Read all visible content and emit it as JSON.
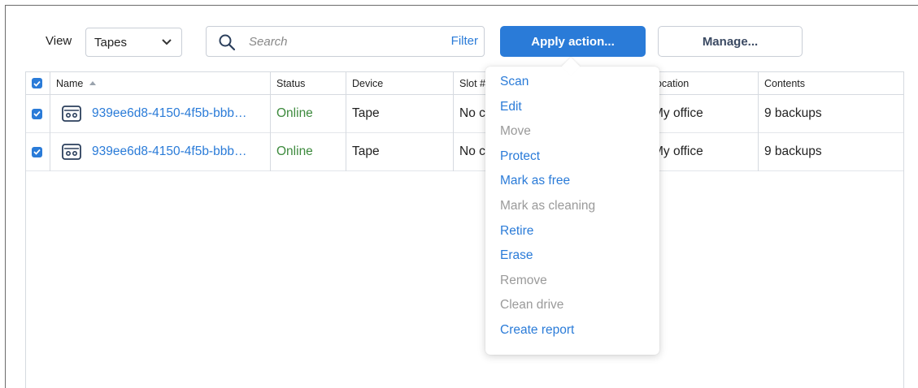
{
  "toolbar": {
    "view_label": "View",
    "view_value": "Tapes",
    "search_placeholder": "Search",
    "filter_label": "Filter",
    "apply_label": "Apply action...",
    "manage_label": "Manage..."
  },
  "table": {
    "columns": [
      "Name",
      "Status",
      "Device",
      "Slot #",
      "Location",
      "Contents"
    ],
    "sort_column": "Name",
    "sort_direction": "ascending",
    "select_all_checked": true,
    "rows": [
      {
        "checked": true,
        "icon": "tape-cassette-icon",
        "name": "939ee6d8-4150-4f5b-bbb…",
        "status": "Online",
        "device": "Tape",
        "slot": "No c",
        "location": "My office",
        "contents": "9 backups"
      },
      {
        "checked": true,
        "icon": "tape-cassette-icon",
        "name": "939ee6d8-4150-4f5b-bbb…",
        "status": "Online",
        "device": "Tape",
        "slot": "No c",
        "location": "My office",
        "contents": "9 backups"
      }
    ]
  },
  "menu": {
    "items": [
      {
        "label": "Scan",
        "enabled": true
      },
      {
        "label": "Edit",
        "enabled": true
      },
      {
        "label": "Move",
        "enabled": false
      },
      {
        "label": "Protect",
        "enabled": true
      },
      {
        "label": "Mark as free",
        "enabled": true
      },
      {
        "label": "Mark as cleaning",
        "enabled": false
      },
      {
        "label": "Retire",
        "enabled": true
      },
      {
        "label": "Erase",
        "enabled": true
      },
      {
        "label": "Remove",
        "enabled": false
      },
      {
        "label": "Clean drive",
        "enabled": false
      },
      {
        "label": "Create report",
        "enabled": true
      }
    ]
  },
  "colors": {
    "accent": "#2a7bd8",
    "online": "#3d8a3d",
    "disabled": "#9a9a9a"
  }
}
